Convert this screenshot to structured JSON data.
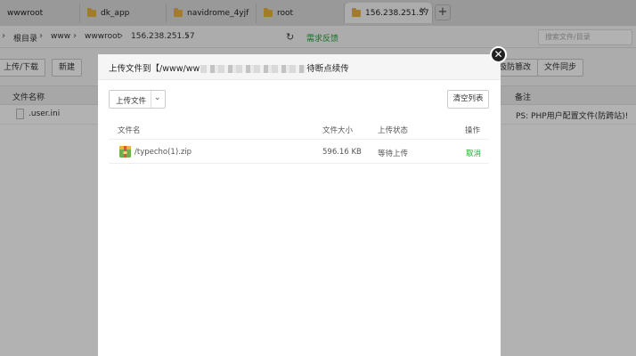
{
  "tabs": [
    {
      "label": "wwwroot"
    },
    {
      "label": "dk_app"
    },
    {
      "label": "navidrome_4yjf"
    },
    {
      "label": "root"
    },
    {
      "label": "156.238.251.57"
    }
  ],
  "tab_close": "✕",
  "tab_add": "+",
  "breadcrumb": [
    "根目录",
    "www",
    "wwwroot",
    "156.238.251.57"
  ],
  "feedback_label": "需求反馈",
  "search_placeholder": "搜索文件/目录",
  "toolbar": {
    "upload_download": "上传/下载",
    "new": "新建",
    "anti_tamper": "极防篡改",
    "file_sync": "文件同步"
  },
  "table": {
    "headers": {
      "name": "文件名称",
      "note": "备注"
    },
    "rows": [
      {
        "name": ".user.ini",
        "note": "PS: PHP用户配置文件(防跨站)!"
      }
    ]
  },
  "dialog": {
    "title_prefix": "上传文件到【/www/ww",
    "title_suffix": "待断点续传",
    "upload_button": "上传文件",
    "clear_button": "清空列表",
    "columns": {
      "name": "文件名",
      "size": "文件大小",
      "status": "上传状态",
      "action": "操作"
    },
    "files": [
      {
        "name": "/typecho(1).zip",
        "size": "596.16 KB",
        "status": "等待上传",
        "action": "取消"
      }
    ]
  },
  "colors": {
    "accent": "#20a53a",
    "folder": "#e8b43a"
  }
}
